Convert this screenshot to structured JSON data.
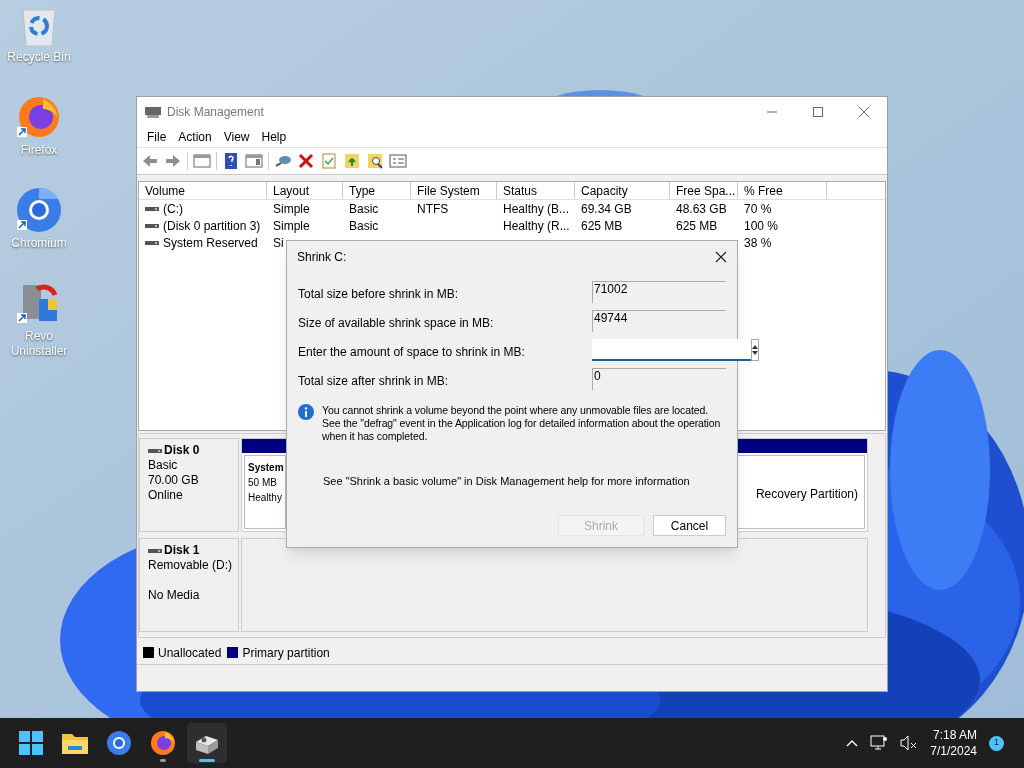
{
  "desktop_icons": [
    {
      "kind": "recycle",
      "label": "Recycle Bin"
    },
    {
      "kind": "firefox",
      "label": "Firefox"
    },
    {
      "kind": "chromium",
      "label": "Chromium"
    },
    {
      "kind": "revo",
      "label": "Revo Uninstaller"
    }
  ],
  "window": {
    "title": "Disk Management",
    "menu": [
      "File",
      "Action",
      "View",
      "Help"
    ],
    "columns": [
      "Volume",
      "Layout",
      "Type",
      "File System",
      "Status",
      "Capacity",
      "Free Spa...",
      "% Free"
    ],
    "rows": [
      {
        "cells": [
          "(C:)",
          "Simple",
          "Basic",
          "NTFS",
          "Healthy (B...",
          "69.34 GB",
          "48.63 GB",
          "70 %"
        ]
      },
      {
        "cells": [
          "(Disk 0 partition 3)",
          "Simple",
          "Basic",
          null,
          "Healthy (R...",
          "625 MB",
          "625 MB",
          "100 %"
        ]
      },
      {
        "cells": [
          "System Reserved",
          "Si",
          null,
          null,
          null,
          null,
          null,
          "38 %"
        ]
      }
    ],
    "disks": [
      {
        "name": "Disk 0",
        "lines": [
          "Basic",
          "70.00 GB",
          "Online"
        ],
        "kind": "basic",
        "partitions": [
          {
            "lines": [
              "System",
              "50 MB",
              "Healthy"
            ],
            "kind": "system"
          },
          {
            "lines": [
              "Recovery Partition)"
            ],
            "kind": "recovery"
          }
        ]
      },
      {
        "name": "Disk 1",
        "lines": [
          "Removable (D:)",
          "No Media"
        ],
        "kind": "removable"
      }
    ],
    "legend": [
      {
        "label": "Unallocated",
        "color": "#000000"
      },
      {
        "label": "Primary partition",
        "color": "#000080"
      }
    ]
  },
  "dialog": {
    "title": "Shrink C:",
    "fields": [
      {
        "label": "Total size before shrink in MB:",
        "value": "71002",
        "kind": "readonly"
      },
      {
        "label": "Size of available shrink space in MB:",
        "value": "49744",
        "kind": "readonly"
      },
      {
        "label": "Enter the amount of space to shrink in MB:",
        "kind": "spin"
      },
      {
        "label": "Total size after shrink in MB:",
        "value": "0",
        "kind": "readonly"
      }
    ],
    "info": "You cannot shrink a volume beyond the point where any unmovable files are located. See the \"defrag\" event in the Application log for detailed information about the operation when it has completed.",
    "help": "See \"Shrink a basic volume\" in Disk Management help for more information",
    "buttons": [
      {
        "label": "Shrink",
        "disabled": true
      },
      {
        "label": "Cancel",
        "disabled": false
      }
    ]
  },
  "taskbar": {
    "apps": [
      {
        "kind": "start",
        "running": false,
        "selected": false
      },
      {
        "kind": "explorer",
        "running": false,
        "selected": false
      },
      {
        "kind": "chromium",
        "running": false,
        "selected": false
      },
      {
        "kind": "firefox",
        "running": true,
        "selected": false
      },
      {
        "kind": "diskmgmt",
        "running": true,
        "selected": true
      }
    ],
    "time": "7:18 AM",
    "date": "7/1/2024",
    "badge": "1"
  }
}
